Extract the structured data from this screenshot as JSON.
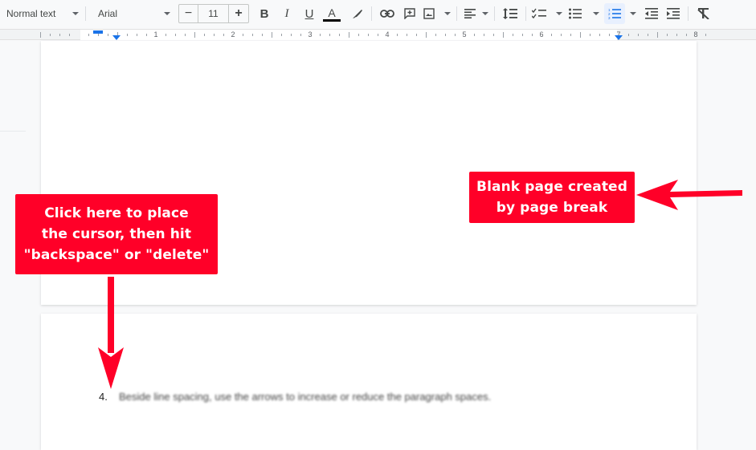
{
  "toolbar": {
    "style_select": "Normal text",
    "font_select": "Arial",
    "font_size": "11",
    "decrease_label": "−",
    "increase_label": "+",
    "icons": [
      "bold-icon",
      "italic-icon",
      "underline-icon",
      "text-color-icon",
      "highlight-icon",
      "link-icon",
      "comment-icon",
      "image-icon",
      "align-icon",
      "line-spacing-icon",
      "checklist-icon",
      "bulleted-list-icon",
      "numbered-list-icon",
      "decrease-indent-icon",
      "increase-indent-icon",
      "clear-formatting-icon"
    ],
    "bold_glyph": "B",
    "italic_glyph": "I",
    "underline_glyph": "U",
    "textcolor_glyph": "A",
    "active_color": "#1a73e8",
    "text_color_bar": "#000000"
  },
  "ruler": {
    "numbers": [
      "1",
      "2",
      "3",
      "4",
      "5",
      "6",
      "7",
      "8"
    ],
    "units": "inches"
  },
  "callouts": {
    "left": {
      "lines": [
        "Click here to place",
        "the cursor, then hit",
        "\"backspace\" or \"delete\""
      ],
      "color": "#ff0028"
    },
    "right": {
      "lines": [
        "Blank page created",
        "by page break"
      ],
      "color": "#ff0028"
    }
  },
  "document": {
    "list_number": "4.",
    "list_text": "Beside line spacing, use the arrows to increase or reduce the paragraph spaces."
  }
}
